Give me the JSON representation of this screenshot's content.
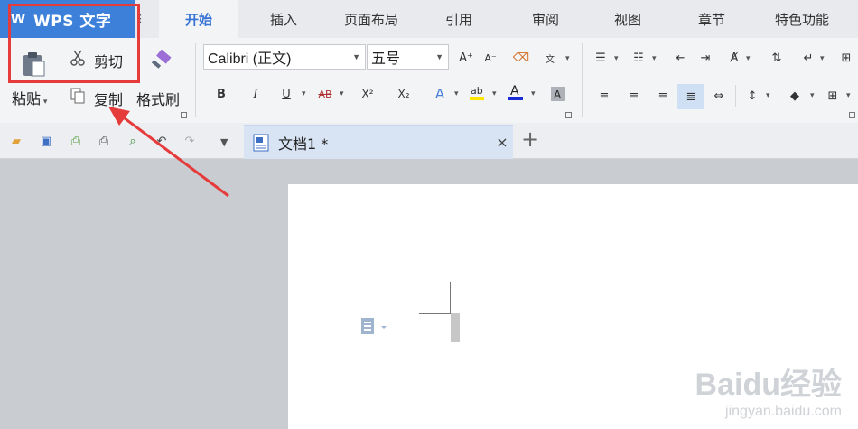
{
  "app": {
    "menu_title": "WPS 文字",
    "logo_glyph": "W",
    "brand_color": "#3d80d9"
  },
  "tabs": [
    {
      "label": "开始",
      "active": true
    },
    {
      "label": "插入"
    },
    {
      "label": "页面布局"
    },
    {
      "label": "引用"
    },
    {
      "label": "审阅"
    },
    {
      "label": "视图"
    },
    {
      "label": "章节"
    },
    {
      "label": "特色功能"
    }
  ],
  "clipboard": {
    "paste_label": "粘贴",
    "cut_label": "剪切",
    "copy_label": "复制",
    "format_painter_label": "格式刷"
  },
  "font": {
    "family_value": "Calibri (正文)",
    "size_value": "五号"
  },
  "format_buttons": {
    "bold": "B",
    "italic": "I",
    "underline": "U",
    "strikethrough": "AB",
    "superscript": "X²",
    "subscript": "X₂",
    "grow_font": "A⁺",
    "shrink_font": "A⁻"
  },
  "document": {
    "tab_title": "文档1 *",
    "add_tab": "+",
    "close": "×"
  },
  "watermark": {
    "brand": "Baidu经验",
    "url": "jingyan.baidu.com"
  },
  "colors": {
    "highlight_box": "#e53b3b",
    "arrow": "#e53b3b",
    "active_tab_text": "#3773d4",
    "font_color_bar": "#1a2bd6",
    "highlight_color_bar": "#ffe600"
  }
}
